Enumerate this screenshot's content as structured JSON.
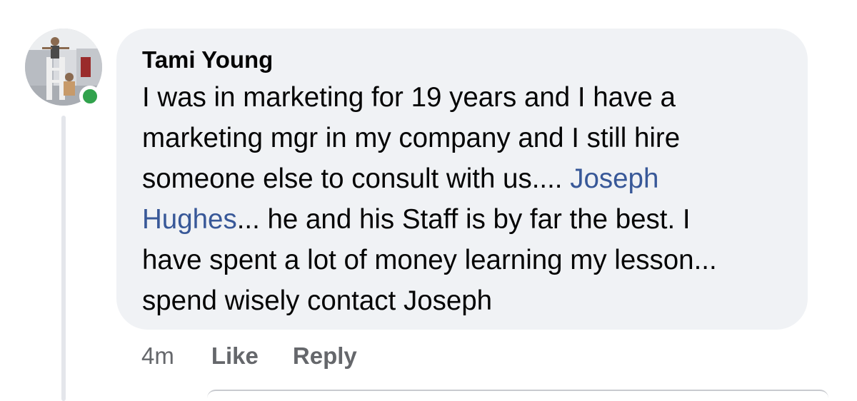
{
  "comment": {
    "author": "Tami Young",
    "online": true,
    "text_lines": [
      [
        {
          "text": "I was in marketing for 19 years and I have a",
          "mention": false
        }
      ],
      [
        {
          "text": "marketing mgr in my company and I still hire",
          "mention": false
        }
      ],
      [
        {
          "text": "someone else to consult with us.... ",
          "mention": false
        },
        {
          "text": "Joseph",
          "mention": true
        }
      ],
      [
        {
          "text": "Hughes",
          "mention": true
        },
        {
          "text": "... he and his Staff is by far the best.  I",
          "mention": false
        }
      ],
      [
        {
          "text": "have spent a lot of money learning my lesson...",
          "mention": false
        }
      ],
      [
        {
          "text": "spend wisely contact Joseph",
          "mention": false
        }
      ]
    ],
    "mention_name": "Joseph Hughes",
    "timestamp": "4m",
    "like_label": "Like",
    "reply_label": "Reply"
  },
  "colors": {
    "bubble_bg": "#f0f2f5",
    "mention": "#385898",
    "online": "#31a24c",
    "meta_text": "#65676b"
  }
}
